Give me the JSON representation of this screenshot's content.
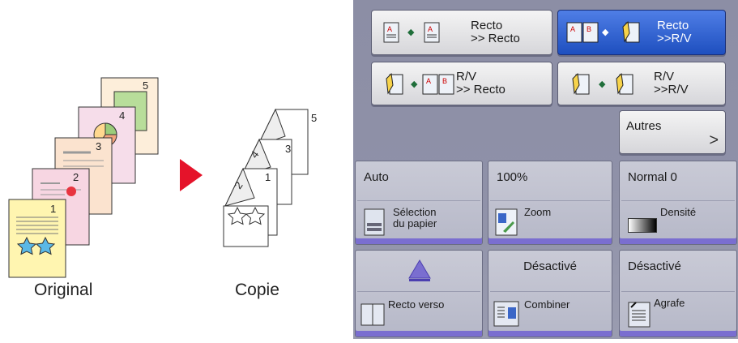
{
  "illustration": {
    "original_caption": "Original",
    "copy_caption": "Copie",
    "page_numbers": [
      "1",
      "2",
      "3",
      "4",
      "5"
    ],
    "copy_page_numbers": [
      "1",
      "2",
      "3",
      "4",
      "5"
    ]
  },
  "panel": {
    "mode_buttons": [
      {
        "label": "Recto\n>> Recto",
        "selected": false
      },
      {
        "label": "Recto\n>>R/V",
        "selected": true
      },
      {
        "label": "R/V\n>> Recto",
        "selected": false
      },
      {
        "label": "R/V\n>>R/V",
        "selected": false
      }
    ],
    "autres": {
      "label": "Autres",
      "chevron": ">"
    },
    "tiles": [
      {
        "value": "Auto",
        "function": "Sélection\ndu papier",
        "icon": "paper-tray-icon"
      },
      {
        "value": "100%",
        "function": "Zoom",
        "icon": "zoom-icon"
      },
      {
        "value": "Normal 0",
        "function": "Densité",
        "icon": "density-gradient-icon"
      },
      {
        "value": "",
        "function": "Recto verso",
        "icon": "duplex-icon"
      },
      {
        "value": "Désactivé",
        "function": "Combiner",
        "icon": "combine-icon"
      },
      {
        "value": "Désactivé",
        "function": "Agrafe",
        "icon": "staple-icon"
      }
    ],
    "colors": {
      "selected": "#1e4fbf",
      "accent": "#7a6ed0",
      "panel": "#8f91a8"
    }
  }
}
